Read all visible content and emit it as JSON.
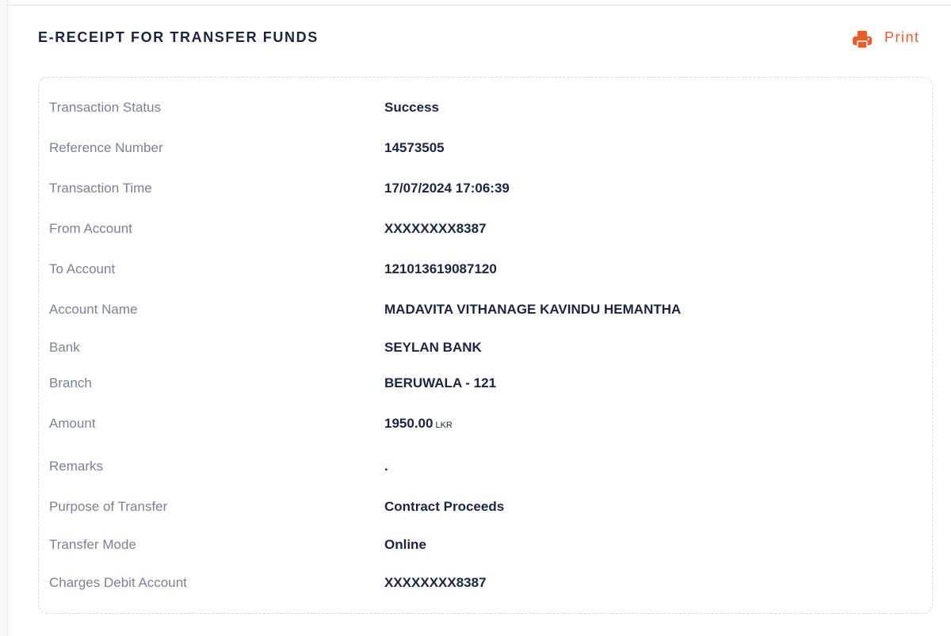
{
  "header": {
    "title": "E-RECEIPT FOR TRANSFER FUNDS",
    "print_label": "Print",
    "print_icon": "printer-icon",
    "accent_color": "#ef5a28"
  },
  "receipt": {
    "transaction_status": {
      "label": "Transaction Status",
      "value": "Success"
    },
    "reference_number": {
      "label": "Reference Number",
      "value": "14573505"
    },
    "transaction_time": {
      "label": "Transaction Time",
      "value": "17/07/2024 17:06:39"
    },
    "from_account": {
      "label": "From Account",
      "value": "XXXXXXXX8387"
    },
    "to_account": {
      "label": "To Account",
      "value": "121013619087120"
    },
    "account_name": {
      "label": "Account Name",
      "value": "MADAVITA VITHANAGE KAVINDU HEMANTHA"
    },
    "bank": {
      "label": "Bank",
      "value": "SEYLAN BANK"
    },
    "branch": {
      "label": "Branch",
      "value": "BERUWALA - 121"
    },
    "amount": {
      "label": "Amount",
      "value": "1950.00",
      "currency": "LKR"
    },
    "remarks": {
      "label": "Remarks",
      "value": "."
    },
    "purpose": {
      "label": "Purpose of Transfer",
      "value": "Contract Proceeds"
    },
    "transfer_mode": {
      "label": "Transfer Mode",
      "value": "Online"
    },
    "charges_debit_account": {
      "label": "Charges Debit Account",
      "value": "XXXXXXXX8387"
    }
  }
}
